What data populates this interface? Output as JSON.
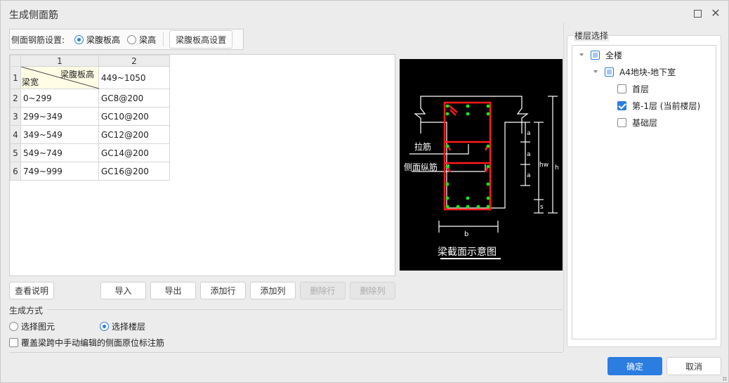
{
  "window": {
    "title": "生成侧面筋",
    "maximize_icon": "maximize-icon",
    "close_icon": "close-icon",
    "close_glyph": "✕"
  },
  "setting": {
    "label": "侧面钢筋设置:",
    "options": [
      {
        "label": "梁腹板高",
        "selected": true
      },
      {
        "label": "梁高",
        "selected": false
      }
    ],
    "config_button": "梁腹板高设置"
  },
  "grid": {
    "column_headers": [
      "1",
      "2"
    ],
    "header_row": {
      "row_num": "1",
      "diag_top_right": "梁腹板高",
      "diag_bottom_left": "梁宽",
      "value": "449~1050"
    },
    "rows": [
      {
        "row_num": "2",
        "width_range": "0~299",
        "rebar": "GC8@200"
      },
      {
        "row_num": "3",
        "width_range": "299~349",
        "rebar": "GC10@200"
      },
      {
        "row_num": "4",
        "width_range": "349~549",
        "rebar": "GC12@200"
      },
      {
        "row_num": "5",
        "width_range": "549~749",
        "rebar": "GC14@200"
      },
      {
        "row_num": "6",
        "width_range": "749~999",
        "rebar": "GC16@200"
      }
    ]
  },
  "diagram": {
    "caption": "梁截面示意图",
    "label_tie": "拉筋",
    "label_side": "侧面纵筋",
    "dim_a": "a",
    "dim_hw": "hw",
    "dim_h": "h",
    "dim_s": "s",
    "dim_b": "b"
  },
  "buttons": {
    "help": "查看说明",
    "import": "导入",
    "export": "导出",
    "add_row": "添加行",
    "add_col": "添加列",
    "delete_row": "删除行",
    "delete_col": "删除列"
  },
  "generation": {
    "group_label": "生成方式",
    "options": [
      {
        "label": "选择图元",
        "selected": false
      },
      {
        "label": "选择楼层",
        "selected": true
      }
    ],
    "override_label": "覆盖梁跨中手动编辑的侧面原位标注筋",
    "override_checked": false
  },
  "floor_select": {
    "title": "楼层选择",
    "tree": [
      {
        "label": "全楼",
        "state": "partial",
        "expandable": true
      },
      {
        "label": "A4地块-地下室",
        "state": "partial",
        "expandable": true
      },
      {
        "label": "首层",
        "state": "unchecked"
      },
      {
        "label": "第-1层 (当前楼层)",
        "state": "checked"
      },
      {
        "label": "基础层",
        "state": "unchecked"
      }
    ]
  },
  "footer": {
    "ok": "确定",
    "cancel": "取消"
  },
  "colors": {
    "accent": "#2b7de0",
    "rebar_red": "#ff1a1a",
    "rebar_dot_green": "#19e619"
  }
}
